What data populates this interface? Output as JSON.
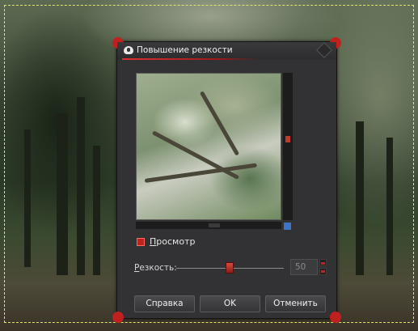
{
  "dialog": {
    "title": "Повышение резкости",
    "preview_label": "Просмотр",
    "preview_checked": true,
    "sharpness": {
      "label": "Резкость:",
      "value": "50",
      "level_percent": 50
    },
    "buttons": {
      "help": "Справка",
      "ok": "OK",
      "cancel": "Отменить"
    }
  },
  "colors": {
    "accent": "#c0231f",
    "selection": "#e9e36a",
    "dialog_bg": "#323234"
  },
  "icons": {
    "title": "eye-icon",
    "titlebar_button": "diamond-icon",
    "navigate": "navigate-icon"
  }
}
